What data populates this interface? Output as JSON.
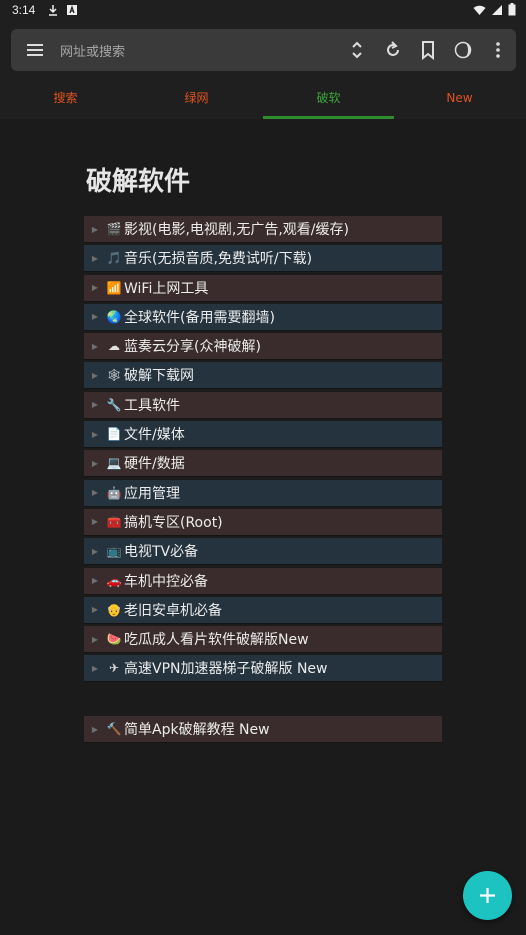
{
  "status": {
    "time": "3:14",
    "icons": [
      "download-icon",
      "a-box-icon",
      "wifi-icon",
      "signal-icon",
      "battery-icon"
    ]
  },
  "urlbar": {
    "placeholder": "网址或搜索",
    "tools": [
      "menu-icon",
      "expand-icon",
      "reload-icon",
      "bookmark-icon",
      "night-mode-icon",
      "more-icon"
    ]
  },
  "tabs": [
    {
      "label": "搜索",
      "color": "#e0531f",
      "active": false
    },
    {
      "label": "绿网",
      "color": "#e0531f",
      "active": false
    },
    {
      "label": "破软",
      "color": "#3aa63a",
      "active": true
    },
    {
      "label": "New",
      "color": "#e0531f",
      "active": false
    }
  ],
  "page": {
    "title": "破解软件"
  },
  "items": [
    {
      "emoji": "🎬",
      "label": "影视(电影,电视剧,无广告,观看/缓存)"
    },
    {
      "emoji": "🎵",
      "label": "音乐(无损音质,免费试听/下载)"
    },
    {
      "emoji": "📶",
      "label": "WiFi上网工具"
    },
    {
      "emoji": "🌏",
      "label": "全球软件(备用需要翻墙)"
    },
    {
      "emoji": "☁",
      "label": "蓝奏云分享(众神破解)"
    },
    {
      "emoji": "🕸",
      "label": "破解下载网"
    },
    {
      "emoji": "🔧",
      "label": "工具软件"
    },
    {
      "emoji": "📄",
      "label": "文件/媒体"
    },
    {
      "emoji": "💻",
      "label": "硬件/数据"
    },
    {
      "emoji": "🤖",
      "label": "应用管理"
    },
    {
      "emoji": "🧰",
      "label": "搞机专区(Root)"
    },
    {
      "emoji": "📺",
      "label": "电视TV必备"
    },
    {
      "emoji": "🚗",
      "label": "车机中控必备"
    },
    {
      "emoji": "👴",
      "label": "老旧安卓机必备"
    },
    {
      "emoji": "🍉",
      "label": "吃瓜成人看片软件破解版New"
    },
    {
      "emoji": "✈",
      "label": "高速VPN加速器梯子破解版 New"
    }
  ],
  "items2": [
    {
      "emoji": "🔨",
      "label": "简单Apk破解教程 New"
    }
  ],
  "fab": {
    "icon": "plus-icon"
  }
}
